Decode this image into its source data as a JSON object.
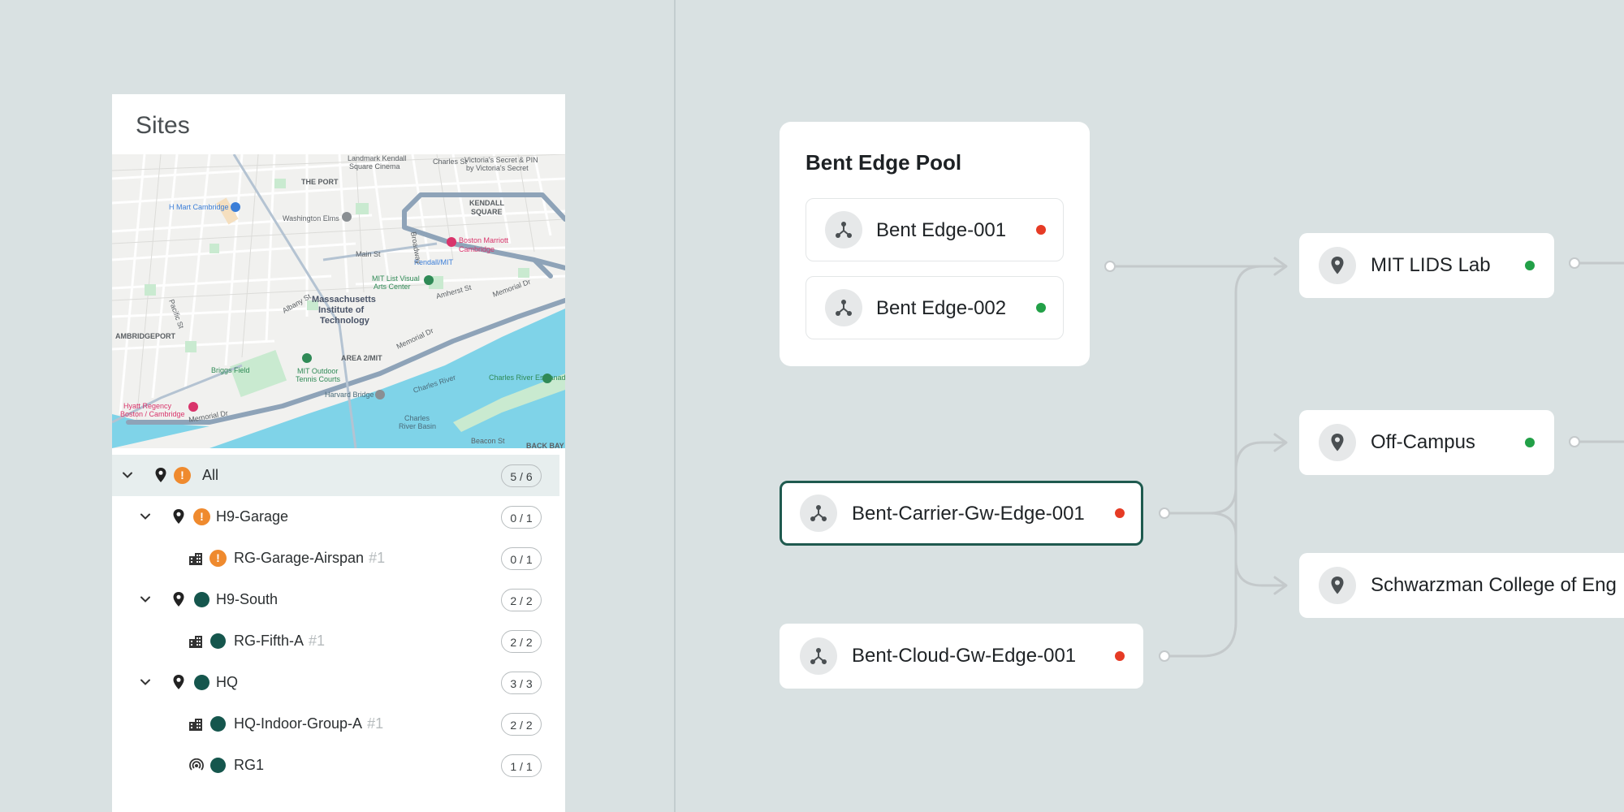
{
  "sites": {
    "title": "Sites",
    "map": {
      "labels": {
        "the_port": "THE PORT",
        "kendall_square": "KENDALL\nSQUARE",
        "mit": "Massachusetts\nInstitute of\nTechnology",
        "cambridgeport": "AMBRIDGEPORT",
        "area2mit": "AREA 2/MIT",
        "h_mart": "H Mart Cambridge",
        "washington_elms": "Washington Elms",
        "boston_marriott": "Boston Marriott\nCambridge",
        "mit_list": "MIT List Visual\nArts Center",
        "kendall_mit": "Kendall/MIT",
        "briggs_field": "Briggs Field",
        "mit_outdoor": "MIT Outdoor\nTennis Courts",
        "harvard_bridge": "Harvard Bridge",
        "charles_river": "Charles River",
        "charles_esplanade": "Charles River Esplanade",
        "charles_basin": "Charles\nRiver Basin",
        "hyatt": "Hyatt Regency\nBoston / Cambridge",
        "memorial_dr": "Memorial Dr",
        "beacon_st": "Beacon St",
        "back_bay": "BACK BAY",
        "main_st": "Main St",
        "broadway": "Broadway",
        "victorias": "Victoria's Secret & PIN\nby Victoria's Secret",
        "landmark": "Landmark Kendall\nSquare Cinema",
        "charles_st": "Charles St",
        "pacific_st": "Pacific St",
        "albany_st": "Albany St",
        "amherst_st": "Amherst St"
      }
    },
    "tree": [
      {
        "label": "All",
        "suffix": "",
        "count": "5 / 6",
        "status": "warning",
        "icon": "pin-icon",
        "level": 0,
        "expanded": true,
        "selected": true
      },
      {
        "label": "H9-Garage",
        "suffix": "",
        "count": "0 / 1",
        "status": "warning",
        "icon": "pin-icon",
        "level": 1,
        "expanded": true
      },
      {
        "label": "RG-Garage-Airspan",
        "suffix": "#1",
        "count": "0 / 1",
        "status": "warning",
        "icon": "building-icon",
        "level": 2
      },
      {
        "label": "H9-South",
        "suffix": "",
        "count": "2 / 2",
        "status": "ok",
        "icon": "pin-icon",
        "level": 1,
        "expanded": true
      },
      {
        "label": "RG-Fifth-A",
        "suffix": "#1",
        "count": "2 / 2",
        "status": "ok",
        "icon": "building-icon",
        "level": 2
      },
      {
        "label": "HQ",
        "suffix": "",
        "count": "3 / 3",
        "status": "ok",
        "icon": "pin-icon",
        "level": 1,
        "expanded": true
      },
      {
        "label": "HQ-Indoor-Group-A",
        "suffix": "#1",
        "count": "2 / 2",
        "status": "ok",
        "icon": "building-icon",
        "level": 2
      },
      {
        "label": "RG1",
        "suffix": "",
        "count": "1 / 1",
        "status": "ok",
        "icon": "radio-icon",
        "level": 2
      }
    ]
  },
  "flow": {
    "pool": {
      "title": "Bent Edge Pool",
      "items": [
        {
          "label": "Bent Edge-001",
          "status": "red"
        },
        {
          "label": "Bent Edge-002",
          "status": "green"
        }
      ]
    },
    "edges": [
      {
        "label": "Bent-Carrier-Gw-Edge-001",
        "status": "red",
        "focused": true
      },
      {
        "label": "Bent-Cloud-Gw-Edge-001",
        "status": "red",
        "focused": false
      }
    ],
    "sites": [
      {
        "label": "MIT LIDS Lab",
        "status": "green"
      },
      {
        "label": "Off-Campus",
        "status": "green"
      },
      {
        "label": "Schwarzman College of Eng",
        "status": "none"
      }
    ]
  },
  "colors": {
    "background": "#d9e1e2",
    "status_red": "#e63b25",
    "status_green": "#22a047",
    "status_warning": "#ef8a2e",
    "status_ok": "#15564d",
    "focus_border": "#1f5a4f",
    "map_water": "#7fd3e8"
  }
}
